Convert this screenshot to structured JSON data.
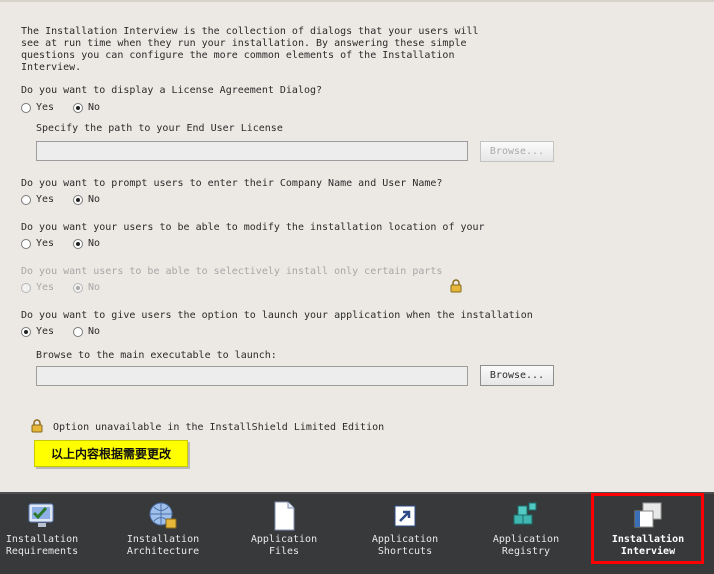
{
  "intro": "The Installation Interview is the collection of dialogs that your users will see at run time when they run your installation. By answering these simple questions you can configure the more common elements of the Installation Interview.",
  "options": {
    "yes": "Yes",
    "no": "No"
  },
  "questions": [
    {
      "text": "Do you want to display a License Agreement Dialog?",
      "selected": "no",
      "enabled": true
    },
    {
      "text": "Do you want to prompt users to enter their Company Name and User Name?",
      "selected": "no",
      "enabled": true
    },
    {
      "text": "Do you want your users to be able to modify the installation location of your",
      "selected": "no",
      "enabled": true
    },
    {
      "text": "Do you want users to be able to selectively install only certain parts",
      "selected": "no",
      "enabled": false
    },
    {
      "text": "Do you want to give users the option to launch your application when the installation",
      "selected": "yes",
      "enabled": true
    }
  ],
  "license": {
    "label": "Specify the path to your End User License",
    "value": "",
    "browse": "Browse..."
  },
  "launch": {
    "label": "Browse to the main executable to launch:",
    "value": "",
    "browse": "Browse..."
  },
  "unavailable_note": "Option unavailable in the InstallShield Limited Edition",
  "annotation": "以上内容根据需要更改",
  "nav": [
    {
      "line1": "Installation",
      "line2": "Requirements",
      "icon": "monitor-check-icon"
    },
    {
      "line1": "Installation",
      "line2": "Architecture",
      "icon": "globe-lock-icon"
    },
    {
      "line1": "Application",
      "line2": "Files",
      "icon": "document-icon"
    },
    {
      "line1": "Application",
      "line2": "Shortcuts",
      "icon": "shortcut-icon"
    },
    {
      "line1": "Application",
      "line2": "Registry",
      "icon": "registry-cubes-icon"
    },
    {
      "line1": "Installation",
      "line2": "Interview",
      "icon": "dialog-windows-icon",
      "active": true
    }
  ],
  "colors": {
    "highlight": "#ff0000",
    "annotation_bg": "#ffff00",
    "navbar_bg": "#38393b"
  }
}
